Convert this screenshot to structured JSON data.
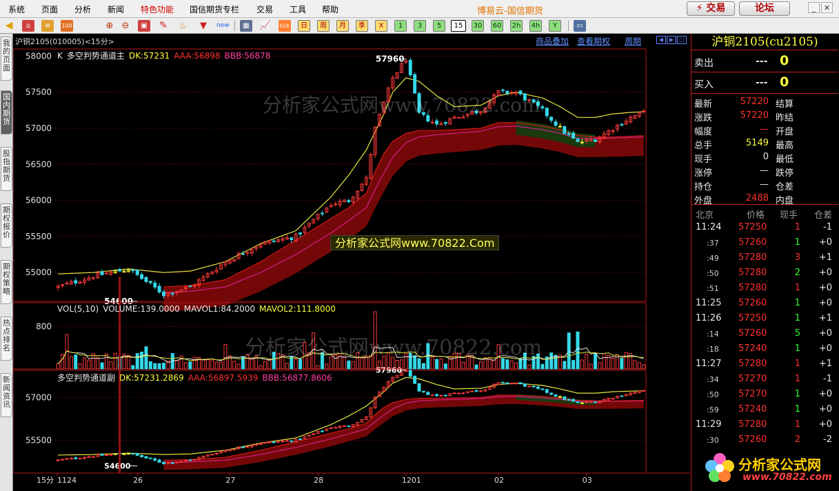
{
  "menu": {
    "items": [
      {
        "label": "系统",
        "special": false
      },
      {
        "label": "页面",
        "special": false
      },
      {
        "label": "分析",
        "special": false
      },
      {
        "label": "新闻",
        "special": false
      },
      {
        "label": "特色功能",
        "special": true
      },
      {
        "label": "国信期货专栏",
        "special": false
      },
      {
        "label": "交易",
        "special": false
      },
      {
        "label": "工具",
        "special": false
      },
      {
        "label": "帮助",
        "special": false
      }
    ],
    "app_title": "博易云-国信期货",
    "trade_button": "⚡ 交易",
    "forum_button": "论坛"
  },
  "toolbar": {
    "periods": [
      "日",
      "周",
      "月",
      "季",
      "X",
      "1",
      "3",
      "5",
      "15",
      "30",
      "60",
      "2h",
      "4h",
      "Y"
    ],
    "active_period": "15"
  },
  "sidetabs": [
    "我的页面",
    "国内期货",
    "股指期货",
    "期权报价",
    "期权策略",
    "热点排名",
    "新闻资讯"
  ],
  "sidetab_active": 1,
  "chart_header": {
    "code": "沪铜2105(010005)<15分>",
    "links": [
      "商品叠加",
      "查看期权",
      "周期"
    ]
  },
  "watermarks": {
    "main": "分析家公式网www.70822.com",
    "volume": "分析家公式网www.70822.com",
    "banner": "分析家公式网www.70822.Com"
  },
  "panes": {
    "main": {
      "title": "多空判势通道主",
      "prefix": "K",
      "dk": "DK:57231",
      "aaa": "AAA:56898",
      "bbb": "BBB:56878",
      "high_label": "57960",
      "low_label": "54600"
    },
    "volume": {
      "title": "VOL(5,10)",
      "volume": "VOLUME:139.0000",
      "mavol1": "MAVOL1:84.2000",
      "mavol2": "MAVOL2:111.8000"
    },
    "sub": {
      "title": "多空判势通道副",
      "dk": "DK:57231.2869",
      "aaa": "AAA:56897.5939",
      "bbb": "BBB:56877.8606",
      "high_label": "57960",
      "low_label": "54600"
    }
  },
  "chart_data": [
    {
      "type": "line",
      "name": "main",
      "ylim": [
        54600,
        58100
      ],
      "yticks": [
        55000,
        55500,
        56000,
        56500,
        57000,
        57500,
        58000
      ],
      "x_labels": [
        "1124",
        "26",
        "27",
        "28",
        "1201",
        "02",
        "03"
      ],
      "x_label_positions": [
        0,
        18,
        39,
        59,
        79,
        100,
        120
      ],
      "period_label": "15分",
      "n_bars": 134,
      "x_anchor_idx": [
        0,
        8,
        16,
        24,
        30,
        38,
        46,
        54,
        62,
        66,
        70,
        72,
        74,
        76,
        79,
        82,
        86,
        90,
        96,
        100,
        104,
        110,
        114,
        118,
        122,
        126,
        130,
        133
      ],
      "close_anchor_vals": [
        54800,
        54950,
        55050,
        54700,
        54800,
        55150,
        55400,
        55500,
        55950,
        56000,
        56300,
        57000,
        57350,
        57700,
        57960,
        57200,
        57050,
        57150,
        57250,
        57500,
        57500,
        57250,
        57000,
        56800,
        56850,
        57000,
        57150,
        57220
      ],
      "dk_anchor_vals": [
        54980,
        55000,
        55050,
        55000,
        55020,
        55150,
        55400,
        55580,
        56050,
        56350,
        56700,
        56950,
        57200,
        57500,
        57700,
        57650,
        57450,
        57300,
        57320,
        57450,
        57500,
        57420,
        57300,
        57150,
        57150,
        57200,
        57220,
        57231
      ],
      "aaa_anchor_vals": [
        null,
        null,
        null,
        54800,
        54820,
        54900,
        55150,
        55450,
        55750,
        55900,
        56100,
        56400,
        56650,
        56820,
        56930,
        56970,
        56970,
        56980,
        57000,
        57080,
        57080,
        57030,
        56980,
        56900,
        56880,
        56880,
        56890,
        56898
      ],
      "bbb_anchor_vals": [
        null,
        null,
        null,
        54720,
        54740,
        54800,
        55000,
        55250,
        55550,
        55720,
        55900,
        56150,
        56380,
        56600,
        56800,
        56880,
        56910,
        56930,
        56960,
        57020,
        57030,
        56980,
        56930,
        56860,
        56860,
        56865,
        56872,
        56878
      ]
    },
    {
      "type": "bar",
      "name": "volume",
      "ylim": [
        0,
        1250
      ],
      "yticks": [
        800
      ],
      "n_bars": 134,
      "tall_bars": [
        [
          2,
          650
        ],
        [
          20,
          420
        ],
        [
          38,
          460
        ],
        [
          56,
          500
        ],
        [
          58,
          680
        ],
        [
          72,
          1080
        ],
        [
          84,
          480
        ],
        [
          100,
          460
        ],
        [
          116,
          680
        ],
        [
          118,
          700
        ]
      ]
    },
    {
      "type": "line",
      "name": "sub",
      "ylim": [
        54350,
        57950
      ],
      "yticks": [
        55500,
        57000
      ]
    }
  ],
  "right_panel": {
    "contract": "沪铜2105(cu2105)",
    "orderbook": [
      {
        "label": "卖出",
        "price": "---",
        "volume": "0"
      },
      {
        "label": "买入",
        "price": "---",
        "volume": "0"
      }
    ],
    "quote_rows": [
      {
        "l1": "最新",
        "v1": "57220",
        "c1": "#ff3030",
        "l2": "结算",
        "v2": ""
      },
      {
        "l1": "涨跌",
        "v1": "57220",
        "c1": "#ff3030",
        "l2": "昨结",
        "v2": ""
      },
      {
        "l1": "幅度",
        "v1": "—",
        "c1": "#ff3030",
        "l2": "开盘",
        "v2": ""
      },
      {
        "l1": "总手",
        "v1": "5149",
        "c1": "#ffff40",
        "l2": "最高",
        "v2": ""
      },
      {
        "l1": "现手",
        "v1": "0",
        "c1": "#e8e8e8",
        "l2": "最低",
        "v2": ""
      },
      {
        "l1": "涨停",
        "v1": "—",
        "c1": "#e8e8e8",
        "l2": "跌停",
        "v2": ""
      },
      {
        "l1": "持仓",
        "v1": "—",
        "c1": "#e8e8e8",
        "l2": "仓差",
        "v2": ""
      },
      {
        "l1": "外盘",
        "v1": "2488",
        "c1": "#ff3030",
        "l2": "内盘",
        "v2": ""
      }
    ],
    "ticks_header": [
      "北京",
      "价格",
      "现手",
      "仓差"
    ],
    "ticks": [
      {
        "time": "11:24",
        "major": true,
        "price": "57250",
        "vol": "1",
        "vol_color": "#ff3030",
        "diff": "-1"
      },
      {
        "time": ":37",
        "major": false,
        "price": "57260",
        "vol": "1",
        "vol_color": "#30ff30",
        "diff": "+0"
      },
      {
        "time": ":49",
        "major": false,
        "price": "57280",
        "vol": "3",
        "vol_color": "#ff3030",
        "diff": "+1"
      },
      {
        "time": ":50",
        "major": false,
        "price": "57280",
        "vol": "2",
        "vol_color": "#30ff30",
        "diff": "+0"
      },
      {
        "time": ":51",
        "major": false,
        "price": "57280",
        "vol": "1",
        "vol_color": "#ff3030",
        "diff": "+0"
      },
      {
        "time": "11:25",
        "major": true,
        "price": "57260",
        "vol": "1",
        "vol_color": "#30ff30",
        "diff": "+0"
      },
      {
        "time": "11:26",
        "major": true,
        "price": "57250",
        "vol": "1",
        "vol_color": "#30ff30",
        "diff": "+1"
      },
      {
        "time": ":14",
        "major": false,
        "price": "57260",
        "vol": "5",
        "vol_color": "#30ff30",
        "diff": "+0"
      },
      {
        "time": ":18",
        "major": false,
        "price": "57240",
        "vol": "1",
        "vol_color": "#30ff30",
        "diff": "+0"
      },
      {
        "time": "11:27",
        "major": true,
        "price": "57280",
        "vol": "1",
        "vol_color": "#ff3030",
        "diff": "+1"
      },
      {
        "time": ":34",
        "major": false,
        "price": "57270",
        "vol": "1",
        "vol_color": "#ff3030",
        "diff": "-1"
      },
      {
        "time": ":50",
        "major": false,
        "price": "57270",
        "vol": "1",
        "vol_color": "#30ff30",
        "diff": "+0"
      },
      {
        "time": ":59",
        "major": false,
        "price": "57240",
        "vol": "1",
        "vol_color": "#30ff30",
        "diff": "+0"
      },
      {
        "time": "11:29",
        "major": true,
        "price": "57280",
        "vol": "1",
        "vol_color": "#ff3030",
        "diff": "+0"
      },
      {
        "time": ":30",
        "major": false,
        "price": "57260",
        "vol": "2",
        "vol_color": "#ff3030",
        "diff": "-2"
      }
    ],
    "logo_text": "分析家公式网",
    "logo_url": "www.70822.com"
  }
}
